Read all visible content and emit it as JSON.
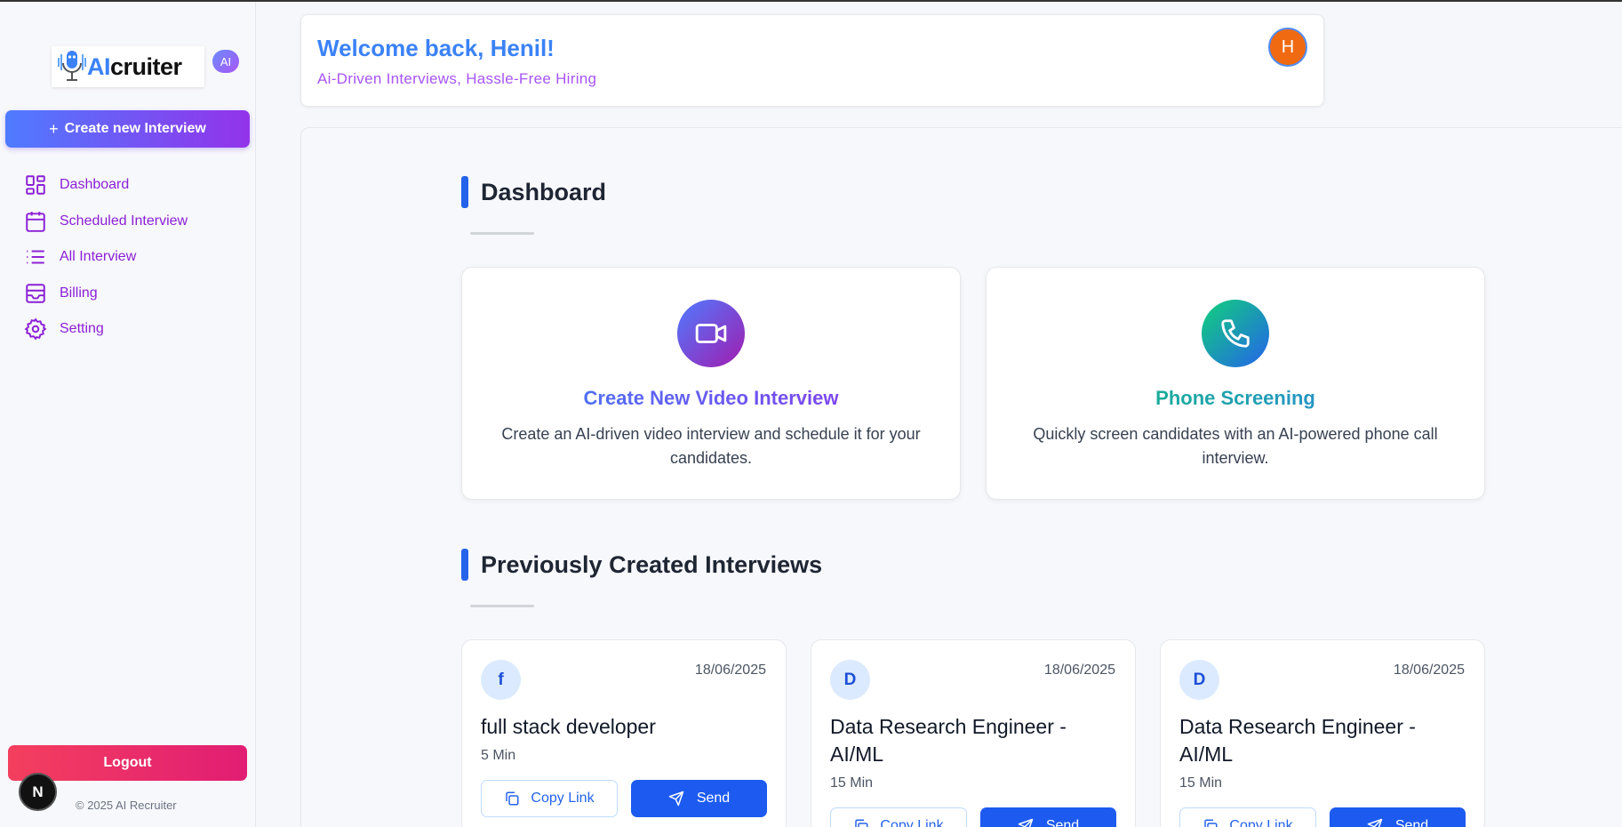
{
  "sidebar": {
    "logo": {
      "ai": "AI",
      "rest": "cruiter"
    },
    "ai_badge": "AI",
    "create_label": "Create new Interview",
    "items": [
      {
        "label": "Dashboard",
        "icon": "dashboard-icon"
      },
      {
        "label": "Scheduled Interview",
        "icon": "calendar-icon"
      },
      {
        "label": "All Interview",
        "icon": "list-icon"
      },
      {
        "label": "Billing",
        "icon": "wallet-icon"
      },
      {
        "label": "Setting",
        "icon": "gear-icon"
      }
    ],
    "logout_label": "Logout",
    "n_badge": "N",
    "copyright": "© 2025 AI Recruiter"
  },
  "header": {
    "welcome": "Welcome back, Henil!",
    "tagline": "Ai-Driven Interviews, Hassle-Free Hiring",
    "avatar_initial": "H"
  },
  "dashboard": {
    "title": "Dashboard",
    "cards": [
      {
        "title": "Create New Video Interview",
        "desc": "Create an AI-driven video interview and schedule it for your candidates.",
        "icon": "video-camera-icon"
      },
      {
        "title": "Phone Screening",
        "desc": "Quickly screen candidates with an AI-powered phone call interview.",
        "icon": "phone-icon"
      }
    ]
  },
  "previous": {
    "title": "Previously Created Interviews",
    "copy_label": "Copy Link",
    "send_label": "Send",
    "interviews": [
      {
        "initial": "f",
        "date": "18/06/2025",
        "title": "full stack developer",
        "duration": "5 Min"
      },
      {
        "initial": "D",
        "date": "18/06/2025",
        "title": "Data Research Engineer - AI/ML",
        "duration": "15 Min"
      },
      {
        "initial": "D",
        "date": "18/06/2025",
        "title": "Data Research Engineer - AI/ML",
        "duration": "15 Min"
      }
    ]
  },
  "colors": {
    "primary_blue": "#3b82f6",
    "purple": "#a855f7",
    "nav_purple": "#8b1fd6",
    "send_blue": "#1d5bf0",
    "logout_pink": "#e11d74",
    "avatar_orange": "#f06a12"
  }
}
